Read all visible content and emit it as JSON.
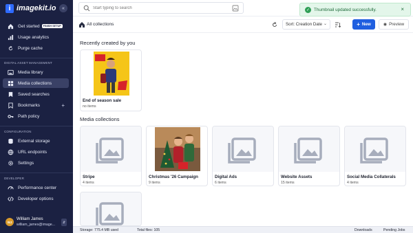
{
  "app": {
    "logo_text": "imagekit.io"
  },
  "sidebar": {
    "getting": [
      {
        "label": "Get started",
        "badge": "FINISH SETUP",
        "icon": "home-icon"
      },
      {
        "label": "Usage analytics",
        "icon": "bar-chart-icon"
      },
      {
        "label": "Purge cache",
        "icon": "refresh-icon"
      }
    ],
    "dam_section": "DIGITAL ASSET MANAGEMENT",
    "dam": [
      {
        "label": "Media library",
        "icon": "image-icon"
      },
      {
        "label": "Media collections",
        "icon": "grid-icon"
      },
      {
        "label": "Saved searches",
        "icon": "bookmark-icon"
      },
      {
        "label": "Bookmarks",
        "icon": "bookmark-outline-icon"
      },
      {
        "label": "Path policy",
        "icon": "key-icon"
      }
    ],
    "config_section": "CONFIGURATION",
    "config": [
      {
        "label": "External storage",
        "icon": "database-icon"
      },
      {
        "label": "URL endpoints",
        "icon": "link-icon"
      },
      {
        "label": "Settings",
        "icon": "gear-icon"
      }
    ],
    "dev_section": "DEVELOPER",
    "dev": [
      {
        "label": "Performance center",
        "icon": "gauge-icon"
      },
      {
        "label": "Developer options",
        "icon": "code-icon"
      }
    ],
    "user": {
      "initials": "WJ",
      "name": "William James",
      "email": "william_james@image..."
    }
  },
  "search": {
    "placeholder": "Start typing to search"
  },
  "toast": {
    "message": "Thumbnail updated successfully."
  },
  "toolbar": {
    "breadcrumb": "All collections",
    "sort_label": "Sort: Creation Date",
    "new_label": "New",
    "preview_label": "Preview"
  },
  "recent": {
    "heading": "Recently created by you",
    "items": [
      {
        "title": "End of season sale",
        "subtitle": "no items"
      }
    ]
  },
  "collections": {
    "heading": "Media collections",
    "items": [
      {
        "title": "Stripe",
        "subtitle": "4 items"
      },
      {
        "title": "Christmas '26 Campaign",
        "subtitle": "9 items"
      },
      {
        "title": "Digital Ads",
        "subtitle": "6 items"
      },
      {
        "title": "Website Assets",
        "subtitle": "15 items"
      },
      {
        "title": "Social Media Collaterals",
        "subtitle": "4 items"
      }
    ]
  },
  "footer": {
    "storage": "Storage: 775.4 MB used",
    "files": "Total files: 105",
    "downloads": "Downloads",
    "pending": "Pending Jobs"
  },
  "colors": {
    "sidebar": "#1b2142",
    "accent": "#1f5fe0",
    "success": "#2e9e55"
  }
}
